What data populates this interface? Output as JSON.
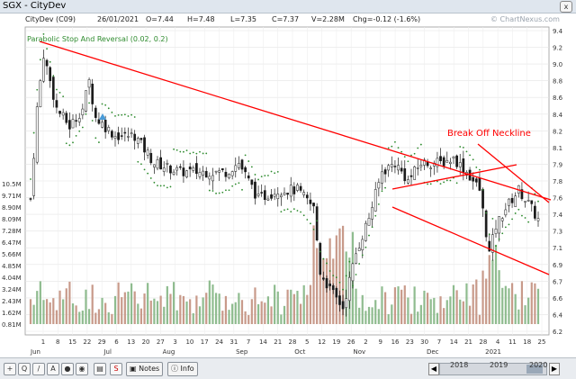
{
  "window": {
    "title": "SGX - CityDev",
    "close_label": "x"
  },
  "info": {
    "name": "CityDev (C09)",
    "date": "26/01/2021",
    "open": "O=7.44",
    "high": "H=7.48",
    "low": "L=7.35",
    "close": "C=7.37",
    "volume": "V=2.28M",
    "change": "Chg=-0.12 (-1.6%)"
  },
  "watermark": "© ChartNexus.com",
  "chart_data": {
    "type": "candlestick",
    "indicator_legend": "Parabolic Stop And Reversal (0.02, 0.2)",
    "price_ticks": [
      9.4,
      9.2,
      9.0,
      8.8,
      8.6,
      8.4,
      8.2,
      8.0,
      7.8,
      7.6,
      7.4,
      7.2,
      7.0,
      6.8,
      6.6,
      6.4,
      6.2
    ],
    "price_labels": [
      "9.4",
      "9.2",
      "9.0",
      "8.8",
      "8.6",
      "8.4",
      "8.2",
      "8.1",
      "7.9",
      "7.8",
      "7.6",
      "7.4",
      "7.3",
      "7.1",
      "6.9",
      "6.7",
      "6.6",
      "6.4",
      "6.2"
    ],
    "volume_labels": [
      "10.5M",
      "9.71M",
      "8.90M",
      "8.09M",
      "7.28M",
      "6.47M",
      "5.66M",
      "4.85M",
      "4.04M",
      "3.24M",
      "2.43M",
      "1.62M",
      "0.81M"
    ],
    "x_tick_labels": [
      "1",
      "8",
      "15",
      "22",
      "29",
      "6",
      "13",
      "20",
      "27",
      "3",
      "10",
      "17",
      "24",
      "31",
      "7",
      "14",
      "21",
      "28",
      "5",
      "12",
      "19",
      "26",
      "2",
      "9",
      "16",
      "23",
      "30",
      "7",
      "14",
      "21",
      "28",
      "4",
      "11",
      "18",
      "25"
    ],
    "month_labels": [
      "Jun",
      "Jul",
      "Aug",
      "Sep",
      "Oct",
      "Nov",
      "Dec",
      "2021"
    ],
    "annotation": "Break Off Neckline",
    "last_close": 7.37,
    "colors": {
      "up": "#1a1a1a",
      "down": "#1a1a1a",
      "trend": "#ff0000",
      "psar": "#2e8b2e",
      "volume_up": "#8fbc8f",
      "volume_down": "#c89a8a"
    }
  },
  "toolbar": {
    "notes_label": "Notes",
    "info_label": "Info",
    "years": [
      "2018",
      "2019",
      "2020"
    ]
  }
}
